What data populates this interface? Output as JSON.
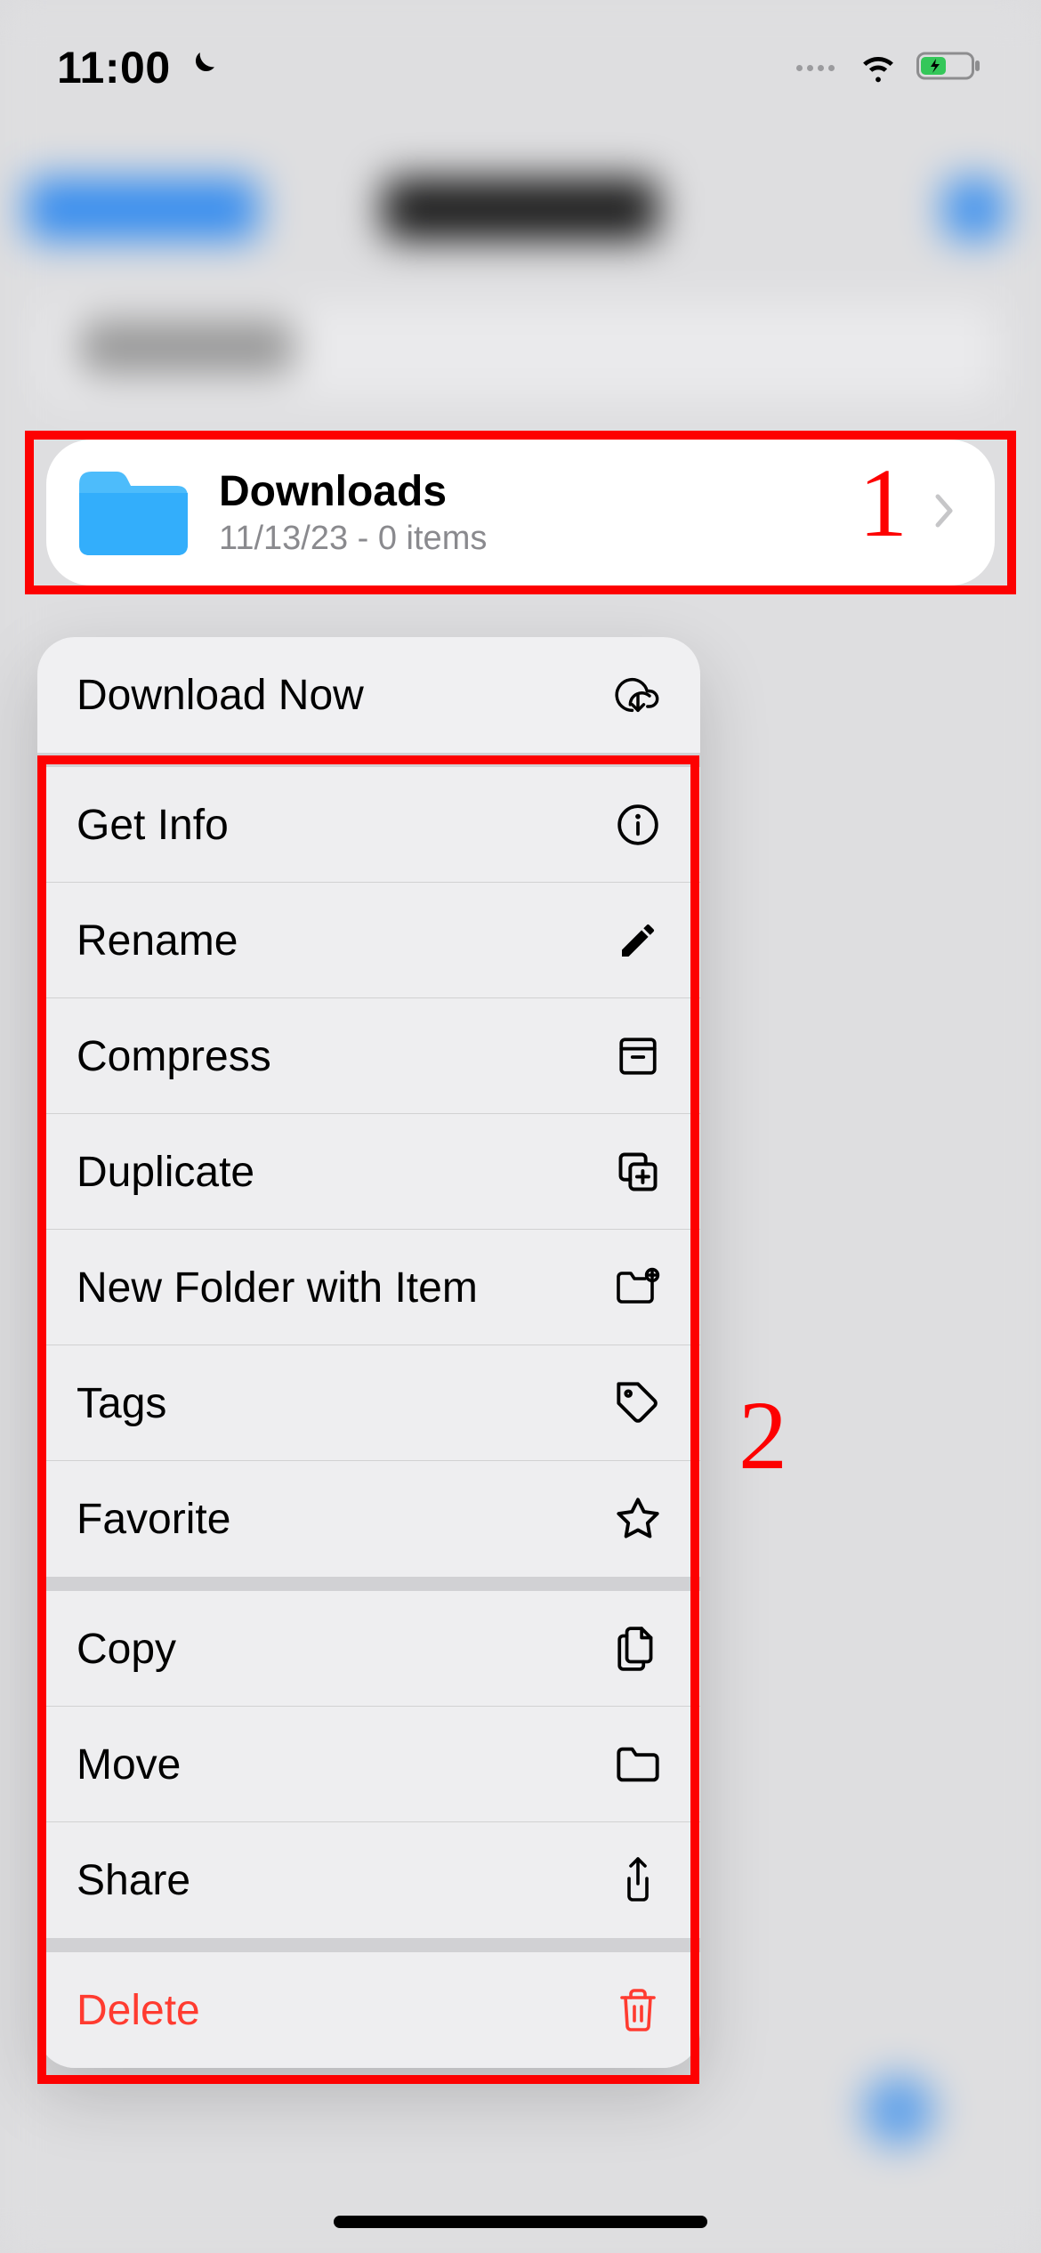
{
  "status_bar": {
    "time": "11:00"
  },
  "folder_card": {
    "title": "Downloads",
    "subtitle": "11/13/23 - 0 items"
  },
  "context_menu": {
    "download_now": "Download Now",
    "get_info": "Get Info",
    "rename": "Rename",
    "compress": "Compress",
    "duplicate": "Duplicate",
    "new_folder": "New Folder with Item",
    "tags": "Tags",
    "favorite": "Favorite",
    "copy": "Copy",
    "move": "Move",
    "share": "Share",
    "delete": "Delete"
  },
  "annotations": {
    "one": "1",
    "two": "2"
  }
}
